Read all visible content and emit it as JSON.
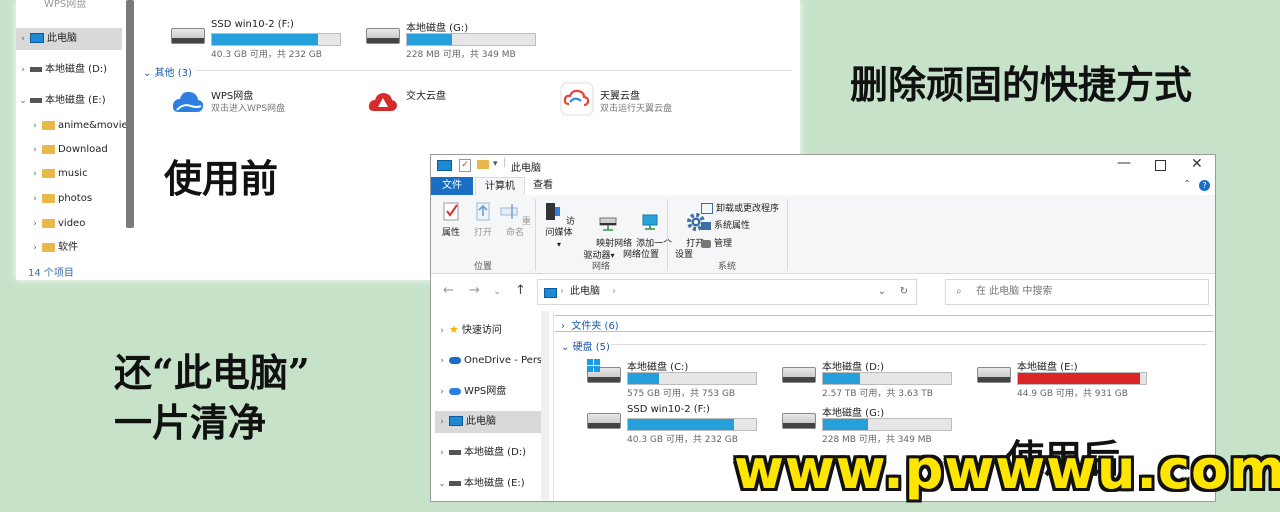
{
  "captions": {
    "title": "删除顽固的快捷方式",
    "before": "使用前",
    "after": "使用后",
    "result_line1": "还“此电脑”",
    "result_line2": "一片清净",
    "watermark": "www.pwwwu.com"
  },
  "before_window": {
    "nav_partial_top": "WPS网盘",
    "nav": [
      {
        "label": "此电脑",
        "icon": "pc-icon",
        "selected": true
      },
      {
        "label": "本地磁盘 (D:)",
        "icon": "drive-icon"
      },
      {
        "label": "本地磁盘 (E:)",
        "icon": "drive-icon",
        "expanded": true
      },
      {
        "label": "anime&movie",
        "icon": "folder-icon"
      },
      {
        "label": "Download",
        "icon": "folder-icon"
      },
      {
        "label": "music",
        "icon": "folder-icon"
      },
      {
        "label": "photos",
        "icon": "folder-icon"
      },
      {
        "label": "video",
        "icon": "folder-icon"
      },
      {
        "label": "软件",
        "icon": "folder-icon"
      }
    ],
    "status": "14 个项目",
    "drives": [
      {
        "name": "SSD win10-2 (F:)",
        "size": "40.3 GB 可用，共 232 GB",
        "used_fraction": 0.83
      },
      {
        "name": "本地磁盘 (G:)",
        "size": "228 MB 可用，共 349 MB",
        "used_fraction": 0.35
      }
    ],
    "others_header": "其他 (3)",
    "others": [
      {
        "name": "WPS网盘",
        "desc": "双击进入WPS网盘",
        "icon": "wps-cloud-icon"
      },
      {
        "name": "交大云盘",
        "desc": "",
        "icon": "jiaoda-cloud-icon"
      },
      {
        "name": "天翼云盘",
        "desc": "双击运行天翼云盘",
        "icon": "tianyi-cloud-icon"
      }
    ]
  },
  "after_window": {
    "title": "此电脑",
    "tabs": [
      "文件",
      "计算机",
      "查看"
    ],
    "ribbon": {
      "location": {
        "group": "位置",
        "buttons": [
          "属性",
          "打开",
          "重命名"
        ]
      },
      "network": {
        "group": "网络",
        "buttons": [
          "访问媒体",
          "映射网络\n驱动器",
          "添加一个\n网络位置"
        ]
      },
      "system": {
        "group": "系统",
        "open_settings": "打开\n设置",
        "small": [
          "卸载或更改程序",
          "系统属性",
          "管理"
        ]
      }
    },
    "address": "此电脑",
    "search_placeholder": "在 此电脑 中搜索",
    "nav": [
      {
        "label": "快速访问",
        "icon": "star-icon"
      },
      {
        "label": "OneDrive - Pers",
        "icon": "onedrive-icon"
      },
      {
        "label": "WPS网盘",
        "icon": "wps-cloud-icon"
      },
      {
        "label": "此电脑",
        "icon": "pc-icon",
        "selected": true
      },
      {
        "label": "本地磁盘 (D:)",
        "icon": "drive-icon"
      },
      {
        "label": "本地磁盘 (E:)",
        "icon": "drive-icon",
        "expanded": true
      }
    ],
    "folders_header": "文件夹 (6)",
    "drives_header": "硬盘 (5)",
    "drives": [
      {
        "name": "本地磁盘 (C:)",
        "size": "575 GB 可用，共 753 GB",
        "used_fraction": 0.24,
        "windows": true
      },
      {
        "name": "本地磁盘 (D:)",
        "size": "2.57 TB 可用，共 3.63 TB",
        "used_fraction": 0.29
      },
      {
        "name": "本地磁盘 (E:)",
        "size": "44.9 GB 可用，共 931 GB",
        "used_fraction": 0.95,
        "critical": true
      },
      {
        "name": "SSD win10-2 (F:)",
        "size": "40.3 GB 可用，共 232 GB",
        "used_fraction": 0.83
      },
      {
        "name": "本地磁盘 (G:)",
        "size": "228 MB 可用，共 349 MB",
        "used_fraction": 0.35
      }
    ]
  },
  "colors": {
    "background": "#c6e3c9",
    "drive_bar": "#26a0da",
    "drive_bar_critical": "#da2626",
    "watermark": "#ffe600"
  }
}
